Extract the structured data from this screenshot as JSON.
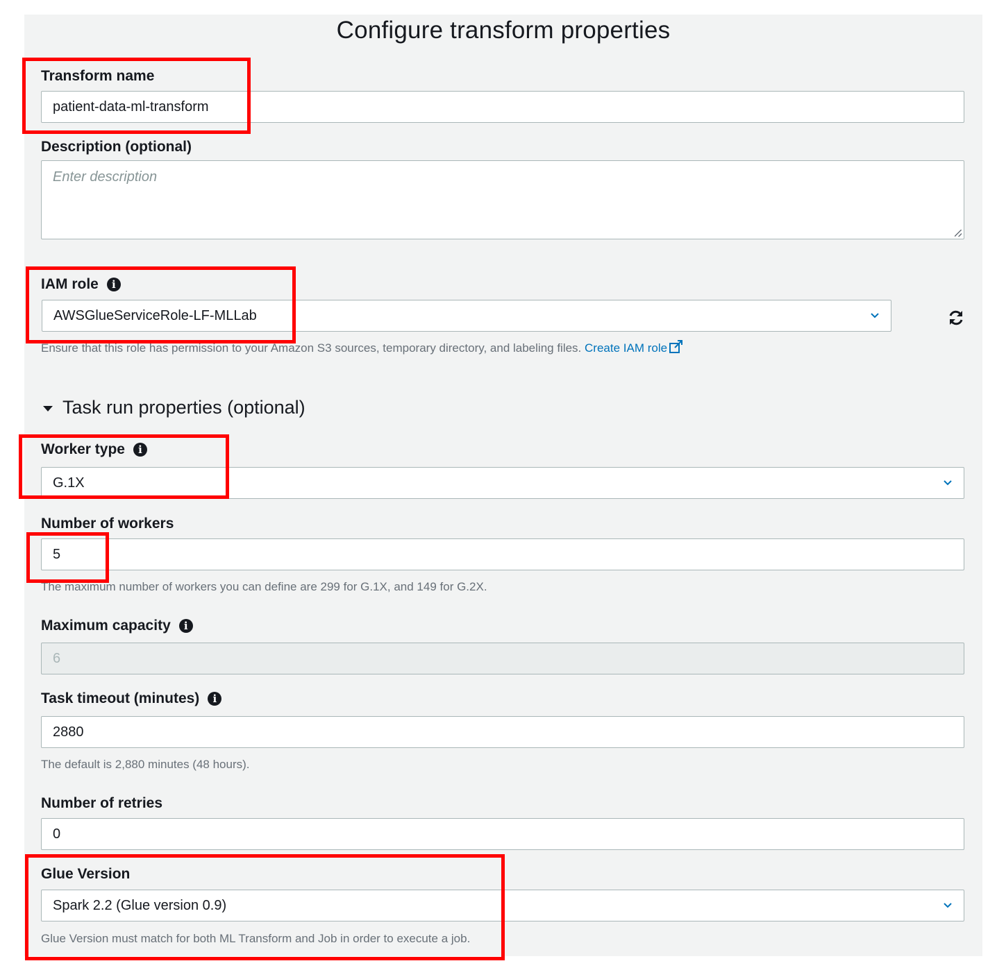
{
  "page": {
    "title": "Configure transform properties"
  },
  "transform_name": {
    "label": "Transform name",
    "value": "patient-data-ml-transform"
  },
  "description": {
    "label": "Description (optional)",
    "placeholder": "Enter description"
  },
  "iam_role": {
    "label": "IAM role",
    "value": "AWSGlueServiceRole-LF-MLLab",
    "hint": "Ensure that this role has permission to your Amazon S3 sources, temporary directory, and labeling files.",
    "link": "Create IAM role"
  },
  "task_run": {
    "section_title": "Task run properties (optional)"
  },
  "worker_type": {
    "label": "Worker type",
    "value": "G.1X"
  },
  "num_workers": {
    "label": "Number of workers",
    "value": "5",
    "hint": "The maximum number of workers you can define are 299 for G.1X, and 149 for G.2X."
  },
  "max_capacity": {
    "label": "Maximum capacity",
    "value": "6"
  },
  "task_timeout": {
    "label": "Task timeout (minutes)",
    "value": "2880",
    "hint": "The default is 2,880 minutes (48 hours)."
  },
  "num_retries": {
    "label": "Number of retries",
    "value": "0"
  },
  "glue_version": {
    "label": "Glue Version",
    "value": "Spark 2.2 (Glue version 0.9)",
    "hint": "Glue Version must match for both ML Transform and Job in order to execute a job."
  },
  "colors": {
    "highlight": "#ff0000",
    "link": "#0073bb",
    "panel": "#f2f3f3"
  },
  "icons": [
    "info-icon",
    "chevron-down-icon",
    "refresh-icon",
    "external-link-icon",
    "caret-down-icon"
  ]
}
